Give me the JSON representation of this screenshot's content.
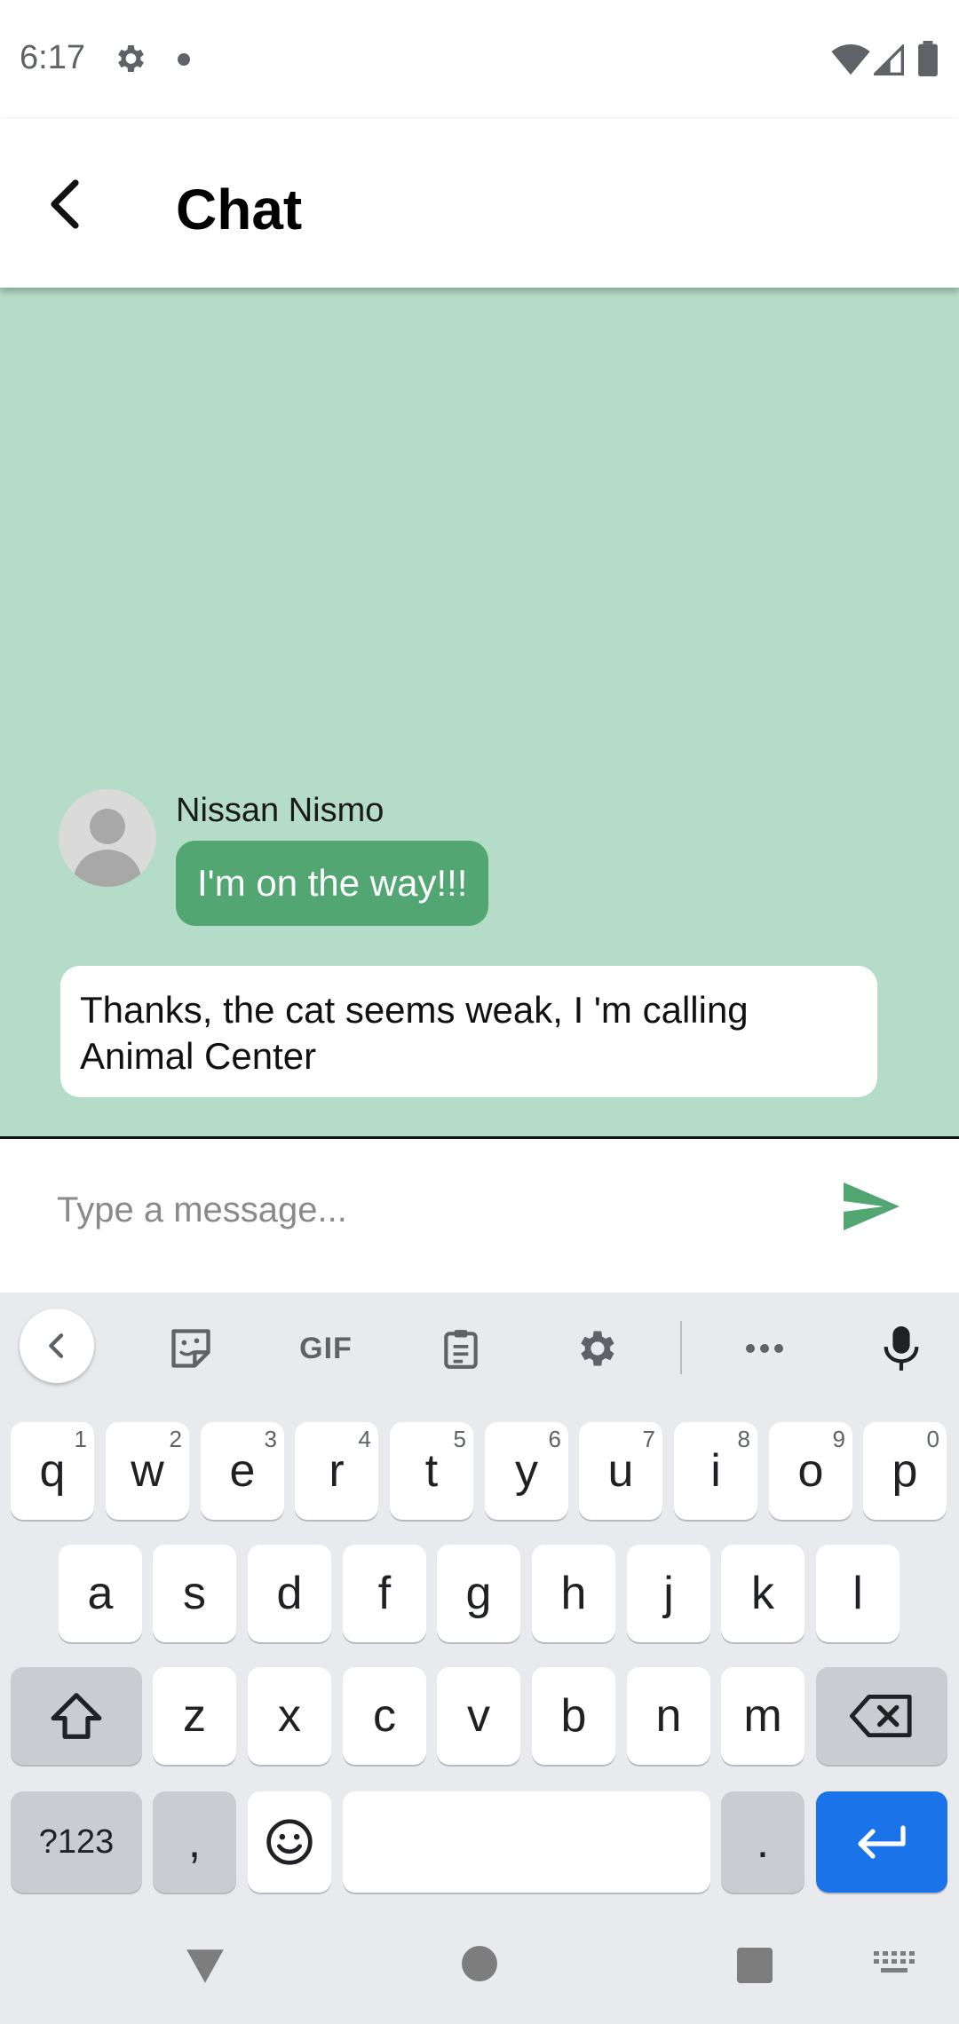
{
  "status_bar": {
    "time": "6:17",
    "icons": [
      "gear-icon",
      "notification-dot-icon",
      "wifi-icon",
      "signal-icon",
      "battery-icon"
    ]
  },
  "app_bar": {
    "title": "Chat",
    "back_icon": "back-arrow-icon"
  },
  "chat": {
    "background_color": "#b4dcc8",
    "messages": [
      {
        "direction": "incoming",
        "sender": "Nissan Nismo",
        "text": "I'm on the way!!!",
        "bubble_color": "#52a672"
      },
      {
        "direction": "outgoing",
        "text": "Thanks, the cat seems weak, I 'm calling Animal Center",
        "bubble_color": "#ffffff"
      }
    ]
  },
  "composer": {
    "placeholder": "Type a message...",
    "value": "",
    "send_icon": "send-icon",
    "send_color": "#52a672"
  },
  "keyboard": {
    "toolbar": {
      "collapse_icon": "chevron-left-icon",
      "sticker_icon": "sticker-icon",
      "gif_label": "GIF",
      "clipboard_icon": "clipboard-icon",
      "settings_icon": "gear-icon",
      "more_icon": "more-horizontal-icon",
      "mic_icon": "microphone-icon"
    },
    "row1": [
      {
        "label": "q",
        "hint": "1"
      },
      {
        "label": "w",
        "hint": "2"
      },
      {
        "label": "e",
        "hint": "3"
      },
      {
        "label": "r",
        "hint": "4"
      },
      {
        "label": "t",
        "hint": "5"
      },
      {
        "label": "y",
        "hint": "6"
      },
      {
        "label": "u",
        "hint": "7"
      },
      {
        "label": "i",
        "hint": "8"
      },
      {
        "label": "o",
        "hint": "9"
      },
      {
        "label": "p",
        "hint": "0"
      }
    ],
    "row2": [
      "a",
      "s",
      "d",
      "f",
      "g",
      "h",
      "j",
      "k",
      "l"
    ],
    "row3": [
      "z",
      "x",
      "c",
      "v",
      "b",
      "n",
      "m"
    ],
    "symbols_label": "?123",
    "comma_label": ",",
    "period_label": ".",
    "enter_color": "#1a73e8"
  },
  "nav_bar": {
    "icons": [
      "nav-back-icon",
      "nav-home-icon",
      "nav-recents-icon",
      "keyboard-switch-icon"
    ]
  }
}
